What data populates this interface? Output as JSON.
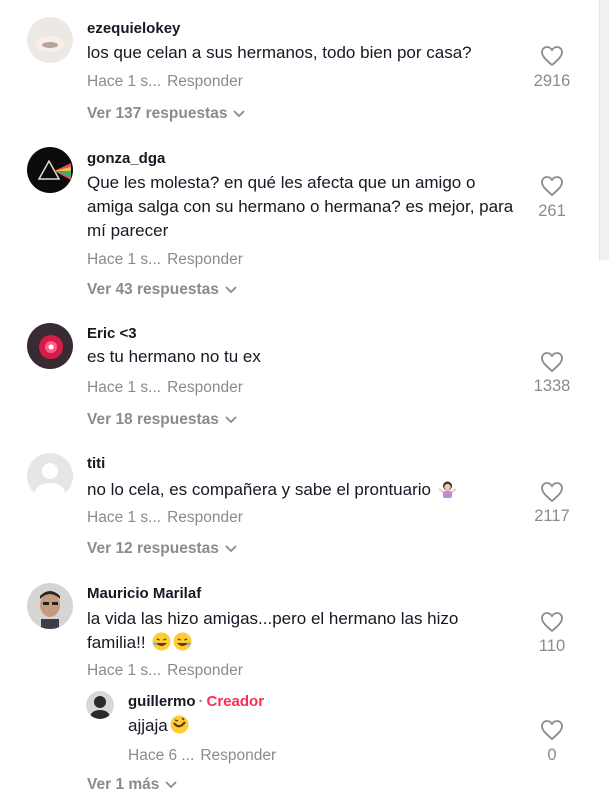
{
  "comments": [
    {
      "username": "ezequielokey",
      "text": "los que celan a sus hermanos, todo bien por casa?",
      "time": "Hace 1 s...",
      "reply_label": "Responder",
      "likes": "2916",
      "view_replies": "Ver 137 respuestas"
    },
    {
      "username": "gonza_dga",
      "text": "Que les molesta? en qué les afecta que un amigo o amiga salga con su hermano o hermana? es mejor, para mí parecer",
      "time": "Hace 1 s...",
      "reply_label": "Responder",
      "likes": "261",
      "view_replies": "Ver 43 respuestas"
    },
    {
      "username": "Eric <3",
      "text": "es tu hermano no tu ex",
      "time": "Hace 1 s...",
      "reply_label": "Responder",
      "likes": "1338",
      "view_replies": "Ver 18 respuestas"
    },
    {
      "username": "titi",
      "text": "no lo cela, es compañera y sabe el prontuario",
      "time": "Hace 1 s...",
      "reply_label": "Responder",
      "likes": "2117",
      "view_replies": "Ver 12 respuestas"
    },
    {
      "username": "Mauricio Marilaf",
      "text": "la vida las hizo amigas...pero el hermano las hizo familia!!",
      "time": "Hace 1 s...",
      "reply_label": "Responder",
      "likes": "110"
    }
  ],
  "reply": {
    "username": "guillermo",
    "separator": "·",
    "badge": "Creador",
    "text": "ajjaja",
    "time": "Hace 6 ...",
    "reply_label": "Responder",
    "likes": "0",
    "view_more": "Ver 1 más"
  },
  "colors": {
    "accent": "#fe2c55",
    "muted": "#8a8b91",
    "text": "#161823"
  }
}
